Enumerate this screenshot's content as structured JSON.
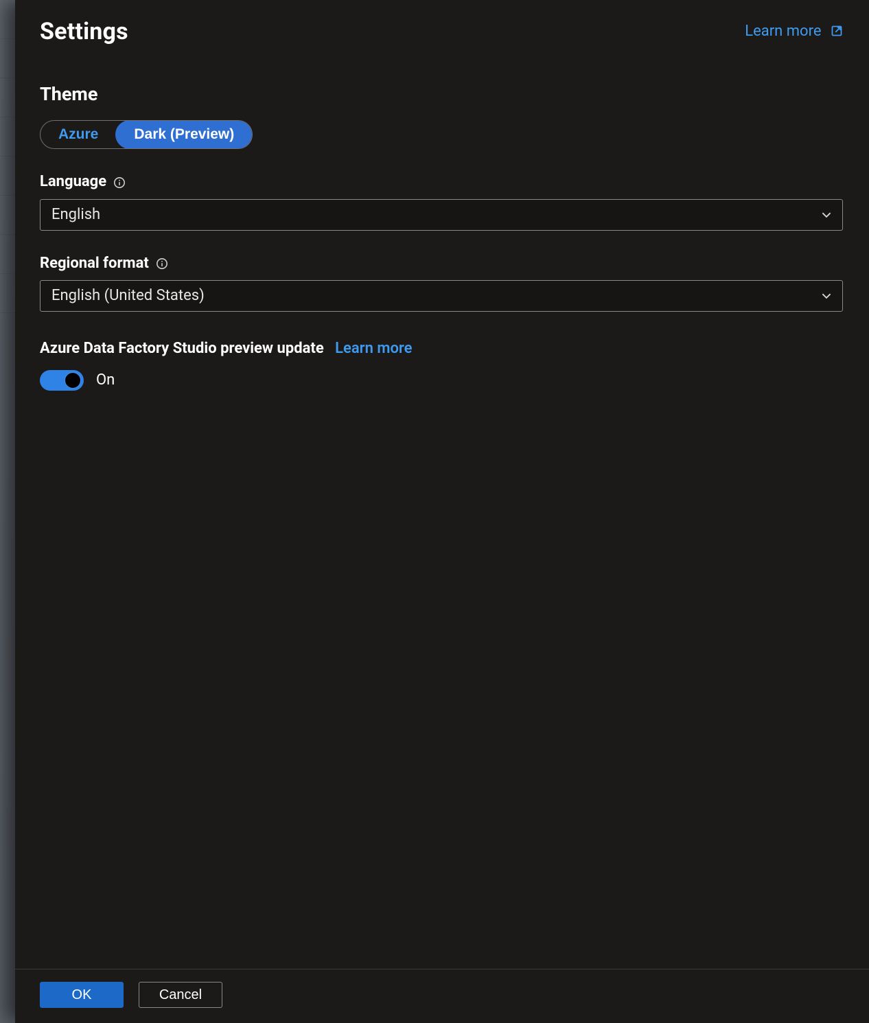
{
  "header": {
    "title": "Settings",
    "learn_more": "Learn more"
  },
  "theme": {
    "title": "Theme",
    "options": [
      "Azure",
      "Dark (Preview)"
    ],
    "selected_index": 1
  },
  "language": {
    "label": "Language",
    "value": "English"
  },
  "regional_format": {
    "label": "Regional format",
    "value": "English (United States)"
  },
  "preview": {
    "label": "Azure Data Factory Studio preview update",
    "learn_more": "Learn more",
    "toggle_state": "On",
    "toggle_on": true
  },
  "footer": {
    "ok": "OK",
    "cancel": "Cancel"
  }
}
